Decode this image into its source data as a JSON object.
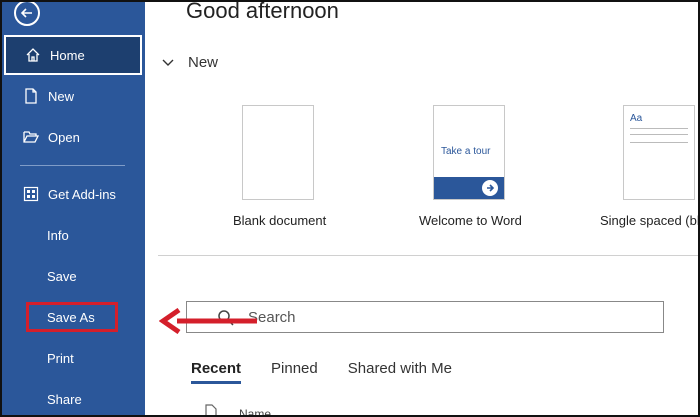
{
  "sidebar": {
    "items": [
      {
        "label": "Home",
        "icon": "home-icon"
      },
      {
        "label": "New",
        "icon": "new-document-icon"
      },
      {
        "label": "Open",
        "icon": "folder-open-icon"
      },
      {
        "label": "Get Add-ins",
        "icon": "add-ins-icon"
      },
      {
        "label": "Info"
      },
      {
        "label": "Save"
      },
      {
        "label": "Save As"
      },
      {
        "label": "Print"
      },
      {
        "label": "Share"
      }
    ]
  },
  "main": {
    "greeting": "Good afternoon",
    "new_section": {
      "label": "New",
      "templates": [
        {
          "label": "Blank document"
        },
        {
          "label": "Welcome to Word",
          "thumb_text": "Take a tour"
        },
        {
          "label": "Single spaced (bla",
          "thumb_text": "Aa"
        }
      ]
    },
    "search": {
      "placeholder": "Search"
    },
    "tabs": [
      "Recent",
      "Pinned",
      "Shared with Me"
    ],
    "list_header": {
      "name": "Name"
    }
  },
  "colors": {
    "sidebar": "#2b579a",
    "sidebar_selected": "#1d3f6f",
    "annotation": "#d41f2b"
  }
}
